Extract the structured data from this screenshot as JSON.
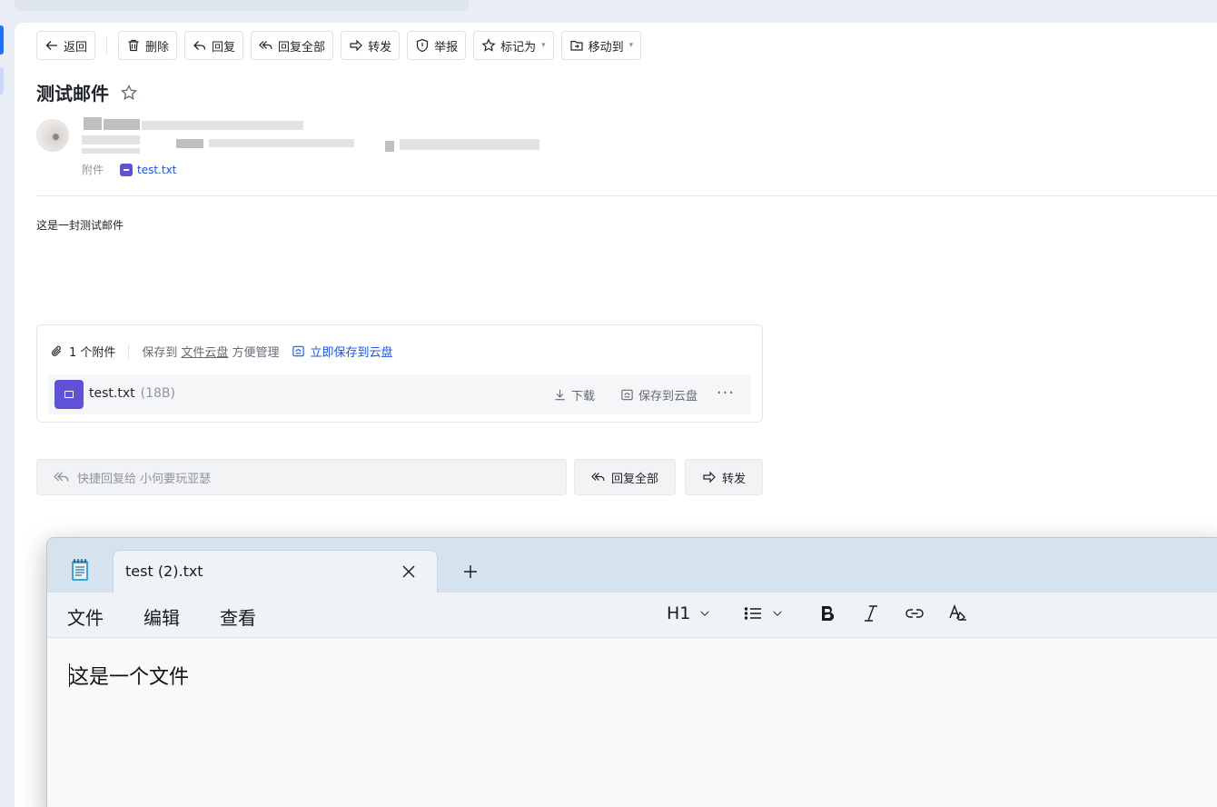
{
  "toolbar": {
    "back": "返回",
    "delete": "删除",
    "reply": "回复",
    "reply_all": "回复全部",
    "forward": "转发",
    "report": "举报",
    "mark_as": "标记为",
    "move_to": "移动到"
  },
  "mail": {
    "subject": "测试邮件",
    "attachment_label": "附件",
    "attachment_file": "test.txt",
    "body": "这是一封测试邮件"
  },
  "attachments": {
    "count_label": "1 个附件",
    "save_prefix": "保存到",
    "save_link": "文件云盘",
    "save_suffix": "方便管理",
    "save_now": "立即保存到云盘",
    "file_name": "test.txt",
    "file_size": "(18B)",
    "download": "下载",
    "save_to_cloud": "保存到云盘",
    "more": "···"
  },
  "quick_reply": {
    "placeholder": "快捷回复给 小何要玩亚瑟",
    "reply_all": "回复全部",
    "forward": "转发"
  },
  "notepad": {
    "tab_title": "test (2).txt",
    "menu_file": "文件",
    "menu_edit": "编辑",
    "menu_view": "查看",
    "heading": "H1",
    "content": "这是一个文件"
  },
  "colors": {
    "accent": "#1456f0",
    "file_badge": "#5f52d8",
    "notepad_title": "#d5e3ef"
  }
}
